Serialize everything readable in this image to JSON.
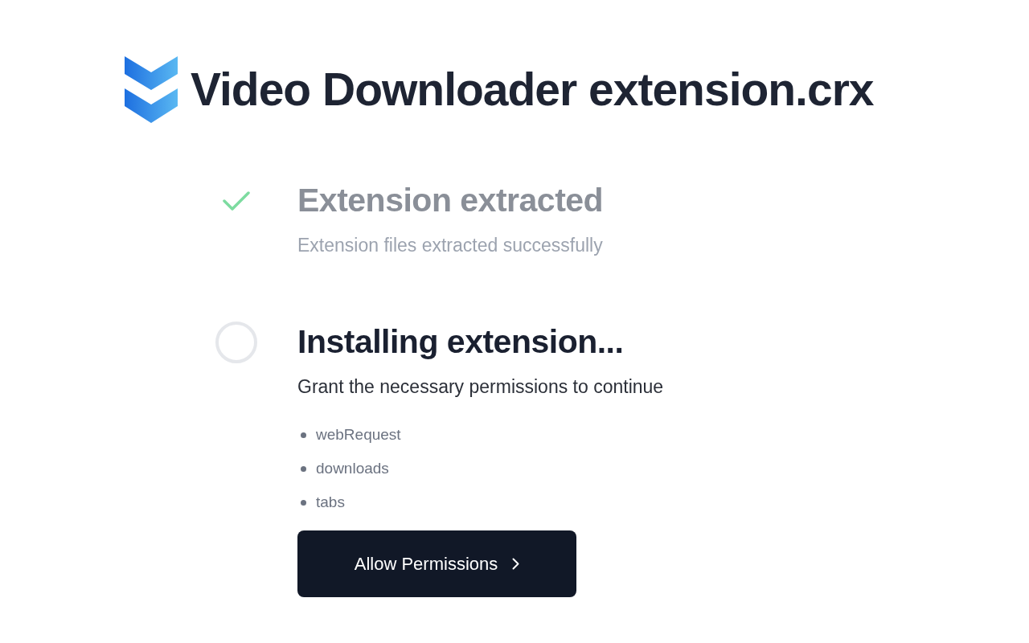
{
  "header": {
    "title": "Video Downloader extension.crx"
  },
  "steps": [
    {
      "kind": "done",
      "title": "Extension extracted",
      "subtitle": "Extension files extracted successfully"
    },
    {
      "kind": "active",
      "title": "Installing extension...",
      "subtitle": "Grant the necessary permissions to continue",
      "permissions": [
        "webRequest",
        "downloads",
        "tabs"
      ],
      "button": {
        "label": "Allow Permissions"
      }
    }
  ]
}
